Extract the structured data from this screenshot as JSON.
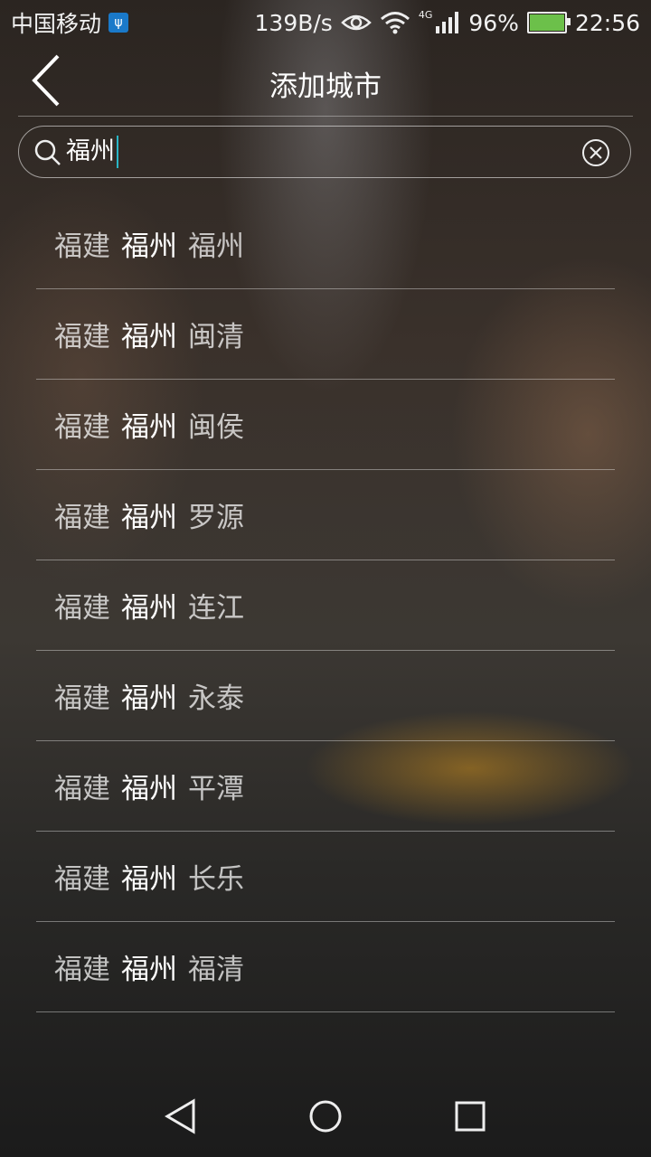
{
  "status_bar": {
    "carrier": "中国移动",
    "net_speed": "139B/s",
    "network": "4G",
    "battery": "96%",
    "time": "22:56"
  },
  "header": {
    "title": "添加城市"
  },
  "search": {
    "value": "福州"
  },
  "results": [
    {
      "province": "福建",
      "city": "福州",
      "district": "福州"
    },
    {
      "province": "福建",
      "city": "福州",
      "district": "闽清"
    },
    {
      "province": "福建",
      "city": "福州",
      "district": "闽侯"
    },
    {
      "province": "福建",
      "city": "福州",
      "district": "罗源"
    },
    {
      "province": "福建",
      "city": "福州",
      "district": "连江"
    },
    {
      "province": "福建",
      "city": "福州",
      "district": "永泰"
    },
    {
      "province": "福建",
      "city": "福州",
      "district": "平潭"
    },
    {
      "province": "福建",
      "city": "福州",
      "district": "长乐"
    },
    {
      "province": "福建",
      "city": "福州",
      "district": "福清"
    }
  ],
  "icons": {
    "back": "chevron-left-icon",
    "search": "search-icon",
    "clear": "clear-icon",
    "nav_back": "triangle-back-icon",
    "nav_home": "circle-home-icon",
    "nav_recents": "square-recents-icon"
  },
  "colors": {
    "caret": "#29b6c6",
    "battery": "#6cc04a",
    "usb_badge": "#1a79c9"
  }
}
